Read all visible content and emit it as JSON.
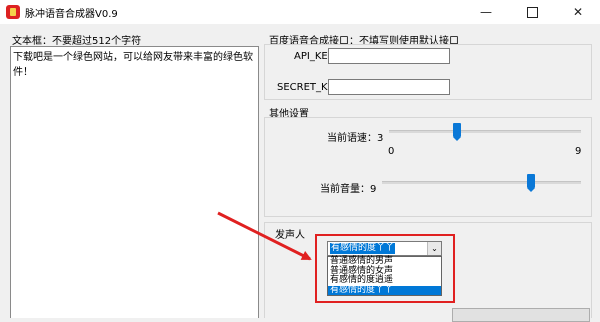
{
  "window": {
    "title": "脉冲语音合成器V0.9",
    "minimize_glyph": "—",
    "close_glyph": "✕"
  },
  "text_box": {
    "label": "文本框：不要超过512个字符",
    "content": "下载吧是一个绿色网站，可以给网友带来丰富的绿色软件！"
  },
  "api": {
    "group_label": "百度语音合成接口：不填写则使用默认接口",
    "api_key_label": "API_KEY",
    "api_key_value": "",
    "secret_key_label": "SECRET_KEY",
    "secret_key_value": ""
  },
  "settings": {
    "group_label": "其他设置",
    "speed_label": "当前语速：3",
    "speed_value": 3,
    "speed_min_label": "0",
    "speed_max_label": "9",
    "volume_label": "当前音量：9",
    "volume_value": 9
  },
  "voice": {
    "group_label": "发声人",
    "selected": "有感情的度丫丫",
    "arrow_glyph": "⌄",
    "options": [
      "普通感情的男声",
      "普通感情的女声",
      "有感情的度逍遥",
      "有感情的度丫丫"
    ],
    "selected_index": 3
  },
  "colors": {
    "accent": "#0078d7",
    "annotation": "#e02020"
  }
}
